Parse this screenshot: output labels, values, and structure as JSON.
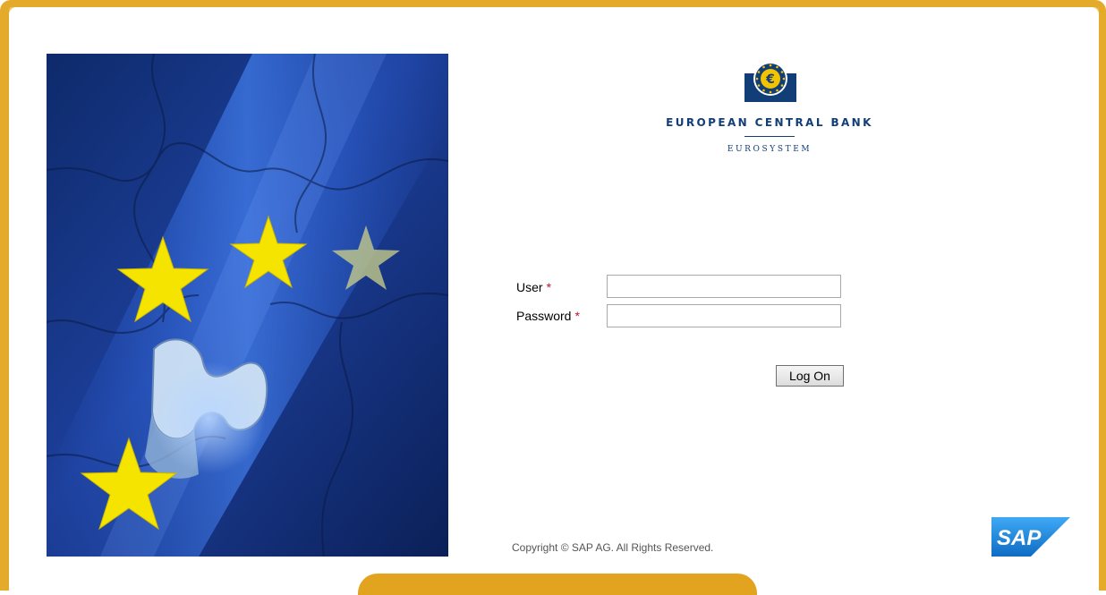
{
  "logo": {
    "name": "EUROPEAN CENTRAL BANK",
    "sub": "EUROSYSTEM"
  },
  "form": {
    "user_label": "User",
    "password_label": "Password",
    "required_mark": "*",
    "user_value": "",
    "password_value": "",
    "logon_label": "Log On"
  },
  "footer": {
    "copyright": "Copyright © SAP AG. All Rights Reserved.",
    "sap_logo_text": "SAP"
  },
  "colors": {
    "frame": "#e4aa2a",
    "brand_blue": "#123e78",
    "required": "#c8102e",
    "sap_blue": "#1a7fd4"
  }
}
